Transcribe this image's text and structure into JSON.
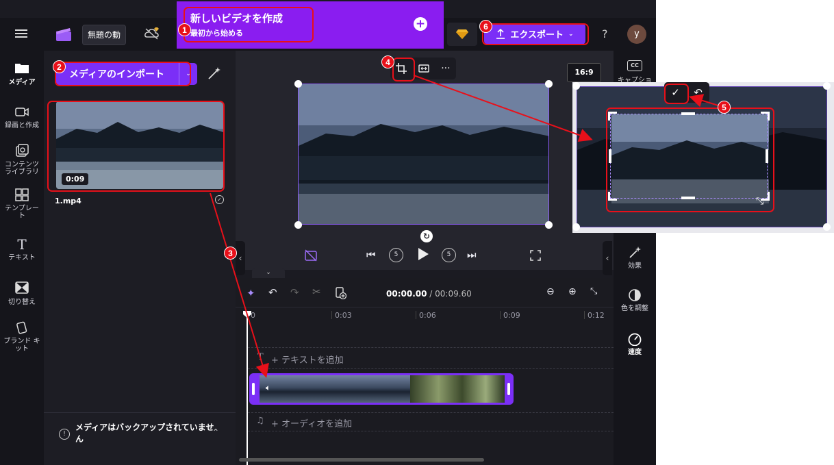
{
  "topbar": {
    "project_name": "無題の動",
    "export_label": "エクスポート",
    "help": "?",
    "avatar_letter": "y"
  },
  "banner": {
    "title": "新しいビデオを作成",
    "subtitle": "最初から始める"
  },
  "left_rail": {
    "items": [
      {
        "label": "メディア",
        "icon": "folder-icon"
      },
      {
        "label": "録画と作成",
        "icon": "video-camera-icon"
      },
      {
        "label": "コンテンツ\nライブラリ",
        "icon": "content-library-icon"
      },
      {
        "label": "テンプレー\nト",
        "icon": "template-icon"
      },
      {
        "label": "テキスト",
        "icon": "text-icon"
      },
      {
        "label": "切り替え",
        "icon": "transition-icon"
      },
      {
        "label": "ブランド キ\nット",
        "icon": "brand-kit-icon"
      }
    ]
  },
  "media": {
    "import_label": "メディアのインポート",
    "clip_duration": "0:09",
    "clip_name": "1.mp4",
    "backup_notice": "メディアはバックアップされていませ\nん"
  },
  "preview": {
    "aspect_ratio": "16:9",
    "captions_label": "キャプショ"
  },
  "right_rail": {
    "items": [
      {
        "label": "効果",
        "icon": "magic-wand-icon"
      },
      {
        "label": "色を調整",
        "icon": "color-adjust-icon"
      },
      {
        "label": "速度",
        "icon": "speedometer-icon"
      }
    ]
  },
  "timeline": {
    "current_time": "00:00.00",
    "total_time": "/ 00:09.60",
    "ruler": [
      "0",
      "0:03",
      "0:06",
      "0:09",
      "0:12"
    ],
    "add_text": "+ テキストを追加",
    "add_audio": "+ オーディオを追加"
  },
  "annotations": [
    "1",
    "2",
    "3",
    "4",
    "5",
    "6"
  ],
  "colors": {
    "accent_purple": "#7b2ff7",
    "banner_purple": "#8a1df0",
    "annotation_red": "#e8101a",
    "app_background": "#1b1b22"
  }
}
